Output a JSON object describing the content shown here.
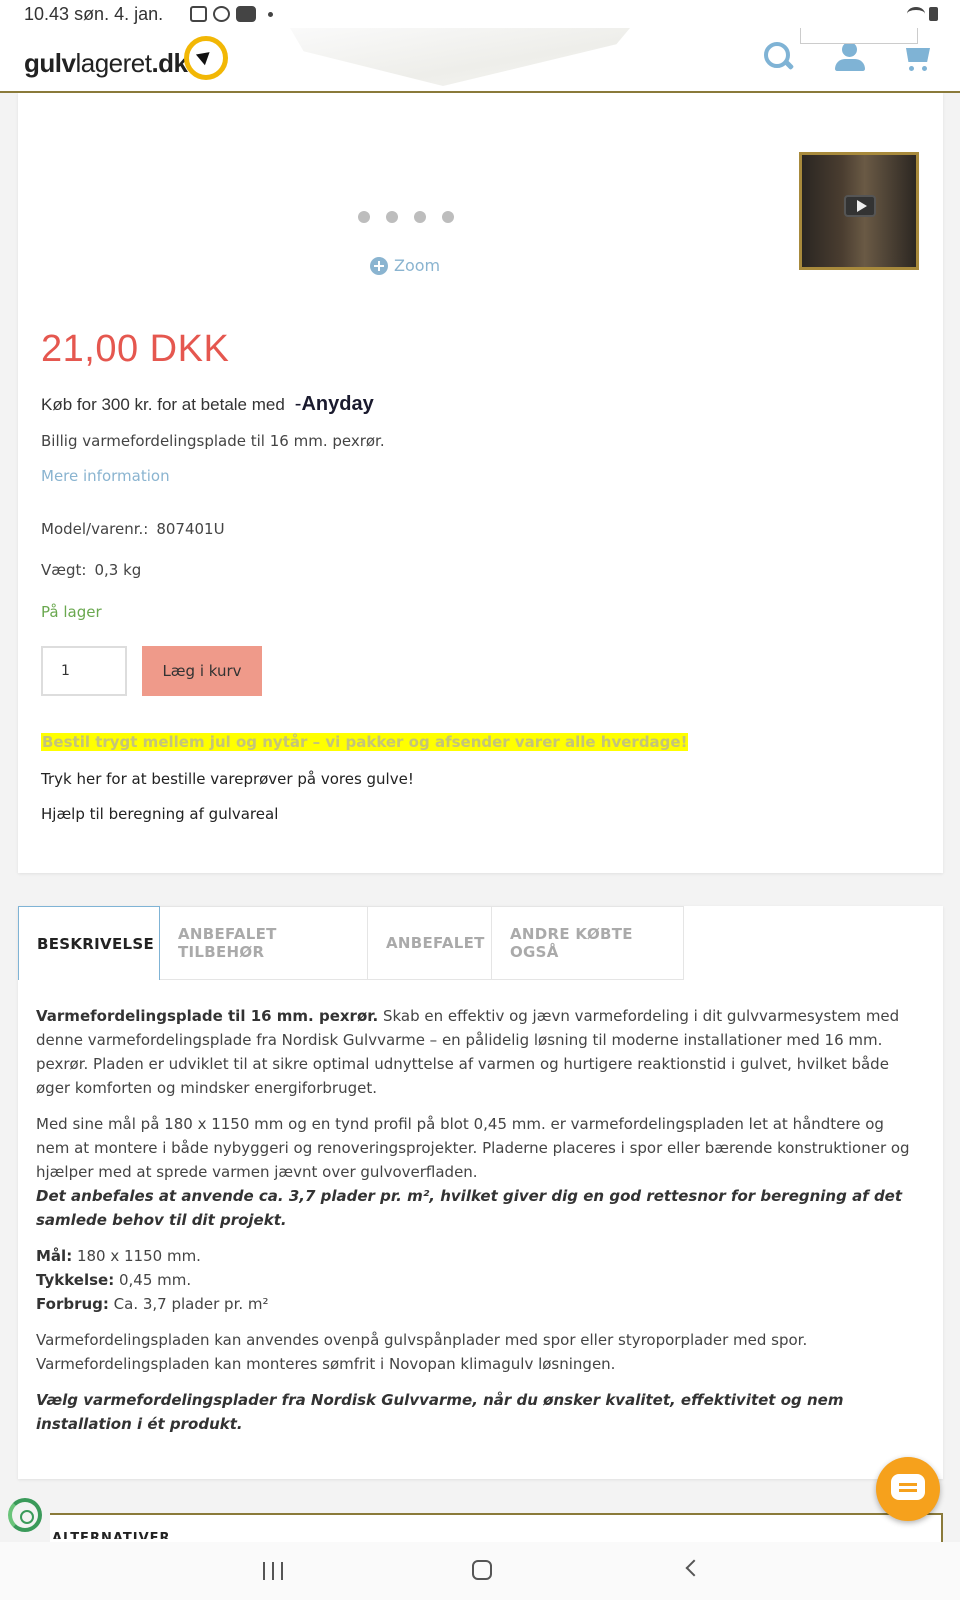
{
  "status_bar": {
    "time": "10.43",
    "date": "søn. 4. jan."
  },
  "header": {
    "logo_part1": "gulv",
    "logo_part2": "lageret",
    "logo_part3": ".dk",
    "icons": [
      "search-icon",
      "user-icon",
      "cart-icon"
    ],
    "accent_color": "#7fb3d5"
  },
  "gallery": {
    "dot_count": 4,
    "zoom_label": "Zoom"
  },
  "product": {
    "price": "21,00 DKK",
    "anyday_text": "Køb for 300 kr. for at betale med",
    "anyday_brand": "Anyday",
    "short_description": "Billig varmefordelingsplade til 16 mm. pexrør.",
    "more_info": "Mere information",
    "model_label": "Model/varenr.:",
    "model_value": "807401U",
    "weight_label": "Vægt:",
    "weight_value": "0,3 kg",
    "stock": "På lager",
    "quantity": "1",
    "add_to_cart": "Læg i kurv",
    "promo": "Bestil trygt mellem jul og nytår – vi pakker og afsender varer alle hverdage!",
    "samples_link": "Tryk her for at bestille vareprøver på vores gulve!",
    "calc_link": "Hjælp til beregning af gulvareal",
    "price_color": "#e5574f",
    "button_color": "#ef9a8a",
    "stock_color": "#6aa84f"
  },
  "tabs": [
    {
      "label": "BESKRIVELSE",
      "active": true
    },
    {
      "label": "ANBEFALET TILBEHØR",
      "active": false
    },
    {
      "label": "ANBEFALET",
      "active": false
    },
    {
      "label": "ANDRE KØBTE OGSÅ",
      "active": false
    }
  ],
  "description": {
    "p1_bold": "Varmefordelingsplade til 16 mm. pexrør.",
    "p1_text": " Skab en effektiv og jævn varmefordeling i dit gulvvarmesystem med denne varmefordelingsplade fra Nordisk Gulvvarme – en pålidelig løsning til moderne installationer med 16 mm. pexrør. Pladen er udviklet til at sikre optimal udnyttelse af varmen og hurtigere reaktionstid i gulvet, hvilket både øger komforten og mindsker energiforbruget.",
    "p2_text": "Med sine mål på 180 x 1150 mm og en tynd profil på blot 0,45 mm. er varmefordelingspladen let at håndtere og nem at montere i både nybyggeri og renoveringsprojekter. Pladerne placeres i spor eller bærende konstruktioner og hjælper med at sprede varmen jævnt over gulvoverfladen.",
    "p2_italic": "Det anbefales at anvende ca. 3,7 plader pr. m², hvilket giver dig en god rettesnor for beregning af det samlede behov til dit projekt.",
    "spec_size_label": "Mål:",
    "spec_size_value": " 180 x 1150 mm.",
    "spec_thickness_label": "Tykkelse:",
    "spec_thickness_value": " 0,45 mm.",
    "spec_usage_label": "Forbrug:",
    "spec_usage_value": " Ca. 3,7 plader pr. m²",
    "p4_line1": "Varmefordelingspladen kan anvendes ovenpå gulvspånplader med spor eller styroporplader med spor.",
    "p4_line2": "Varmefordelingspladen kan monteres sømfrit i Novopan klimagulv løsningen.",
    "p5_italic": "Vælg varmefordelingsplader fra Nordisk Gulvvarme, når du ønsker kvalitet, effektivitet og nem installation i ét produkt."
  },
  "alternatives": {
    "title": "ALTERNATIVER"
  }
}
